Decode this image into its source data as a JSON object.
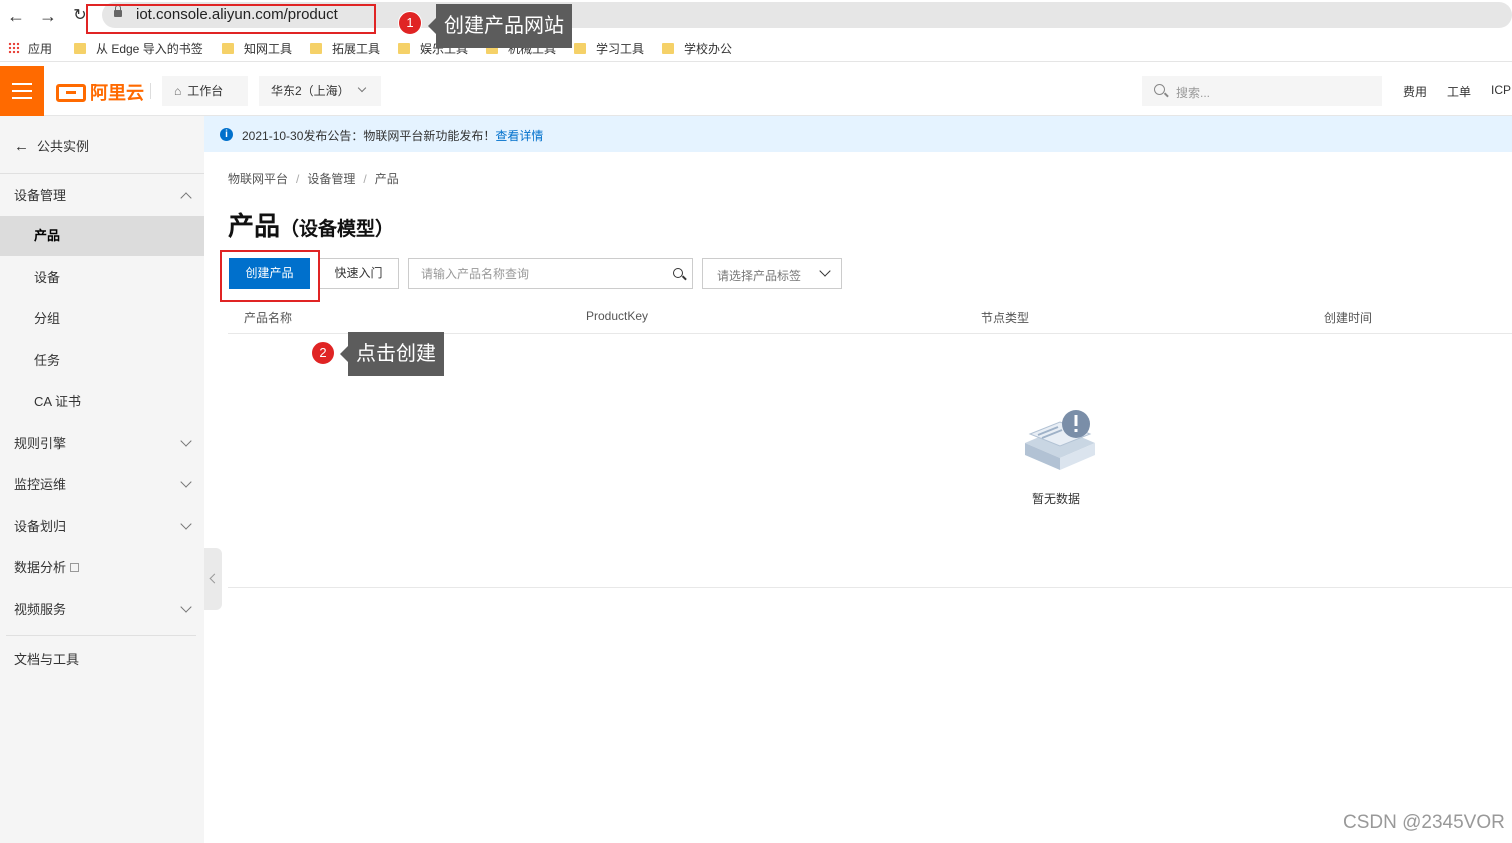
{
  "browser": {
    "url": "iot.console.aliyun.com/product",
    "bookmarks": [
      "应用",
      "从 Edge 导入的书签",
      "知网工具",
      "拓展工具",
      "娱乐工具",
      "机械工具",
      "学习工具",
      "学校办公"
    ]
  },
  "topbar": {
    "logo": "阿里云",
    "workbench": "工作台",
    "region": "华东2（上海）",
    "search_placeholder": "搜索...",
    "links": [
      "费用",
      "工单",
      "ICP"
    ]
  },
  "sidebar": {
    "back": "公共实例",
    "group": "设备管理",
    "subitems": [
      "产品",
      "设备",
      "分组",
      "任务",
      "CA 证书"
    ],
    "items": [
      "规则引擎",
      "监控运维",
      "设备划归",
      "数据分析",
      "视频服务"
    ],
    "footer": "文档与工具"
  },
  "notice": {
    "text": "2021-10-30发布公告：物联网平台新功能发布！",
    "link": "查看详情"
  },
  "breadcrumb": [
    "物联网平台",
    "设备管理",
    "产品"
  ],
  "page": {
    "title": "产品",
    "subtitle": "（设备模型）"
  },
  "toolbar": {
    "create": "创建产品",
    "quickstart": "快速入门",
    "search_placeholder": "请输入产品名称查询",
    "tag_placeholder": "请选择产品标签"
  },
  "table": {
    "columns": [
      "产品名称",
      "ProductKey",
      "节点类型",
      "创建时间"
    ],
    "empty": "暂无数据"
  },
  "annotations": {
    "badge1": "1",
    "callout1": "创建产品网站",
    "badge2": "2",
    "callout2": "点击创建"
  },
  "watermark": "CSDN @2345VOR",
  "colors": {
    "brand": "#ff6a00",
    "primary": "#0070cc",
    "annotation": "#e02424"
  }
}
